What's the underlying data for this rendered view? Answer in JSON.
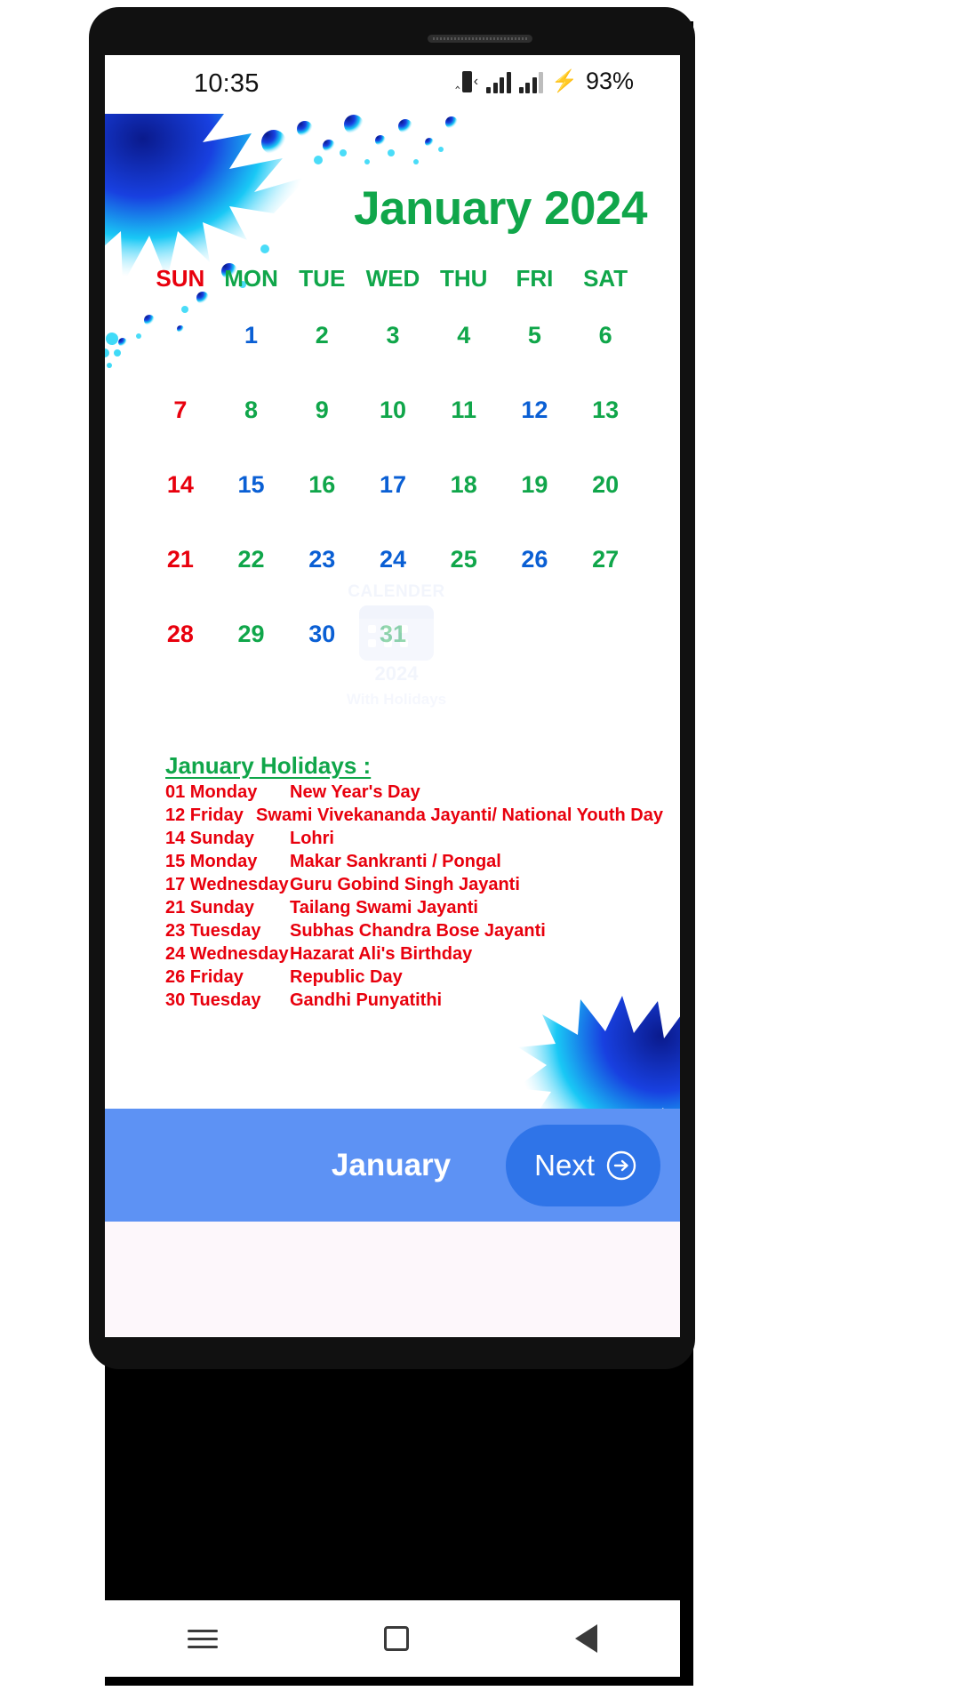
{
  "status_bar": {
    "time": "10:35",
    "battery": "93%",
    "icons": [
      "vibrate-icon",
      "signal-icon",
      "signal-icon",
      "charging-bolt-icon"
    ]
  },
  "header": {
    "title": "January 2024",
    "title_color": "#10a64a"
  },
  "calendar": {
    "weekdays": [
      "SUN",
      "MON",
      "TUE",
      "WED",
      "THU",
      "FRI",
      "SAT"
    ],
    "weeks": [
      [
        {
          "n": "",
          "c": "empty"
        },
        {
          "n": "1",
          "c": "b"
        },
        {
          "n": "2",
          "c": "g"
        },
        {
          "n": "3",
          "c": "g"
        },
        {
          "n": "4",
          "c": "g"
        },
        {
          "n": "5",
          "c": "g"
        },
        {
          "n": "6",
          "c": "g"
        }
      ],
      [
        {
          "n": "7",
          "c": "r"
        },
        {
          "n": "8",
          "c": "g"
        },
        {
          "n": "9",
          "c": "g"
        },
        {
          "n": "10",
          "c": "g"
        },
        {
          "n": "11",
          "c": "g"
        },
        {
          "n": "12",
          "c": "b"
        },
        {
          "n": "13",
          "c": "g"
        }
      ],
      [
        {
          "n": "14",
          "c": "r"
        },
        {
          "n": "15",
          "c": "b"
        },
        {
          "n": "16",
          "c": "g"
        },
        {
          "n": "17",
          "c": "b"
        },
        {
          "n": "18",
          "c": "g"
        },
        {
          "n": "19",
          "c": "g"
        },
        {
          "n": "20",
          "c": "g"
        }
      ],
      [
        {
          "n": "21",
          "c": "r"
        },
        {
          "n": "22",
          "c": "g"
        },
        {
          "n": "23",
          "c": "b"
        },
        {
          "n": "24",
          "c": "b"
        },
        {
          "n": "25",
          "c": "g"
        },
        {
          "n": "26",
          "c": "b"
        },
        {
          "n": "27",
          "c": "g"
        }
      ],
      [
        {
          "n": "28",
          "c": "r"
        },
        {
          "n": "29",
          "c": "g"
        },
        {
          "n": "30",
          "c": "b"
        },
        {
          "n": "31",
          "c": "g"
        },
        {
          "n": "",
          "c": "empty"
        },
        {
          "n": "",
          "c": "empty"
        },
        {
          "n": "",
          "c": "empty"
        }
      ]
    ],
    "colors": {
      "sunday": "#e8000d",
      "weekday": "#10a64a",
      "holiday": "#0a5fd4"
    }
  },
  "watermark": {
    "title": "CALENDER",
    "year": "2024",
    "subtitle": "With Holidays"
  },
  "holidays": {
    "heading": "January Holidays :",
    "items": [
      {
        "date": "01 Monday",
        "name": "New Year's Day"
      },
      {
        "date": "12 Friday",
        "name": "Swami Vivekananda Jayanti/ National Youth Day"
      },
      {
        "date": "14 Sunday",
        "name": "Lohri"
      },
      {
        "date": "15 Monday",
        "name": "Makar Sankranti / Pongal"
      },
      {
        "date": "17 Wednesday",
        "name": "Guru Gobind Singh Jayanti"
      },
      {
        "date": "21 Sunday",
        "name": "Tailang Swami Jayanti"
      },
      {
        "date": "23 Tuesday",
        "name": "Subhas Chandra Bose Jayanti"
      },
      {
        "date": "24 Wednesday",
        "name": "Hazarat Ali's Birthday"
      },
      {
        "date": "26 Friday",
        "name": "Republic Day"
      },
      {
        "date": "30 Tuesday",
        "name": "Gandhi Punyatithi"
      }
    ],
    "text_color": "#e8000d"
  },
  "bottom_bar": {
    "month_label": "January",
    "next_label": "Next",
    "bar_color": "#5d92f4",
    "button_color": "#2f74e8"
  },
  "nav_bar": {
    "items": [
      "menu-icon",
      "home-icon",
      "back-icon"
    ]
  }
}
